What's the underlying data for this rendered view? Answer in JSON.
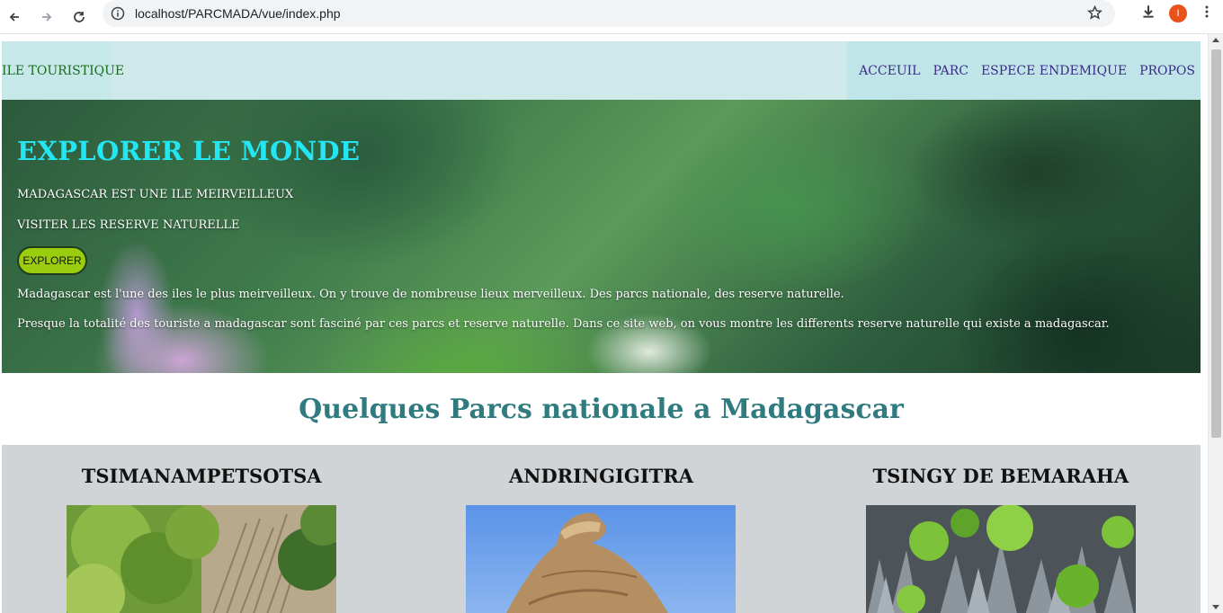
{
  "browser": {
    "url": "localhost/PARCMADA/vue/index.php",
    "profile_initial": "I"
  },
  "header": {
    "logo": "ILE TOURISTIQUE",
    "nav": [
      "ACCEUIL",
      "PARC",
      "ESPECE ENDEMIQUE",
      "PROPOS"
    ]
  },
  "hero": {
    "title": "EXPLORER LE MONDE",
    "subtitle1": "MADAGASCAR EST UNE ILE MEIRVEILLEUX",
    "subtitle2": "VISITER LES RESERVE NATURELLE",
    "button": "EXPLORER",
    "paragraph1": "Madagascar est l'une des iles le plus meirveilleux. On y trouve de nombreuse lieux merveilleux. Des parcs nationale, des reserve naturelle.",
    "paragraph2": "Presque la totalité des touriste a madagascar sont fasciné par ces parcs et reserve naturelle. Dans ce site web, on vous montre les differents reserve naturelle qui existe a madagascar."
  },
  "section": {
    "title": "Quelques Parcs nationale a Madagascar"
  },
  "parks": [
    {
      "name": "TSIMANAMPETSOTSA"
    },
    {
      "name": "ANDRINGIGITRA"
    },
    {
      "name": "TSINGY DE BEMARAHA"
    }
  ],
  "colors": {
    "header_bg": "#cfe8ea",
    "hero_title": "#24e6f2",
    "button_bg": "#9acd0e",
    "section_title": "#2f7b80",
    "parks_bg": "#d0d4d6"
  }
}
